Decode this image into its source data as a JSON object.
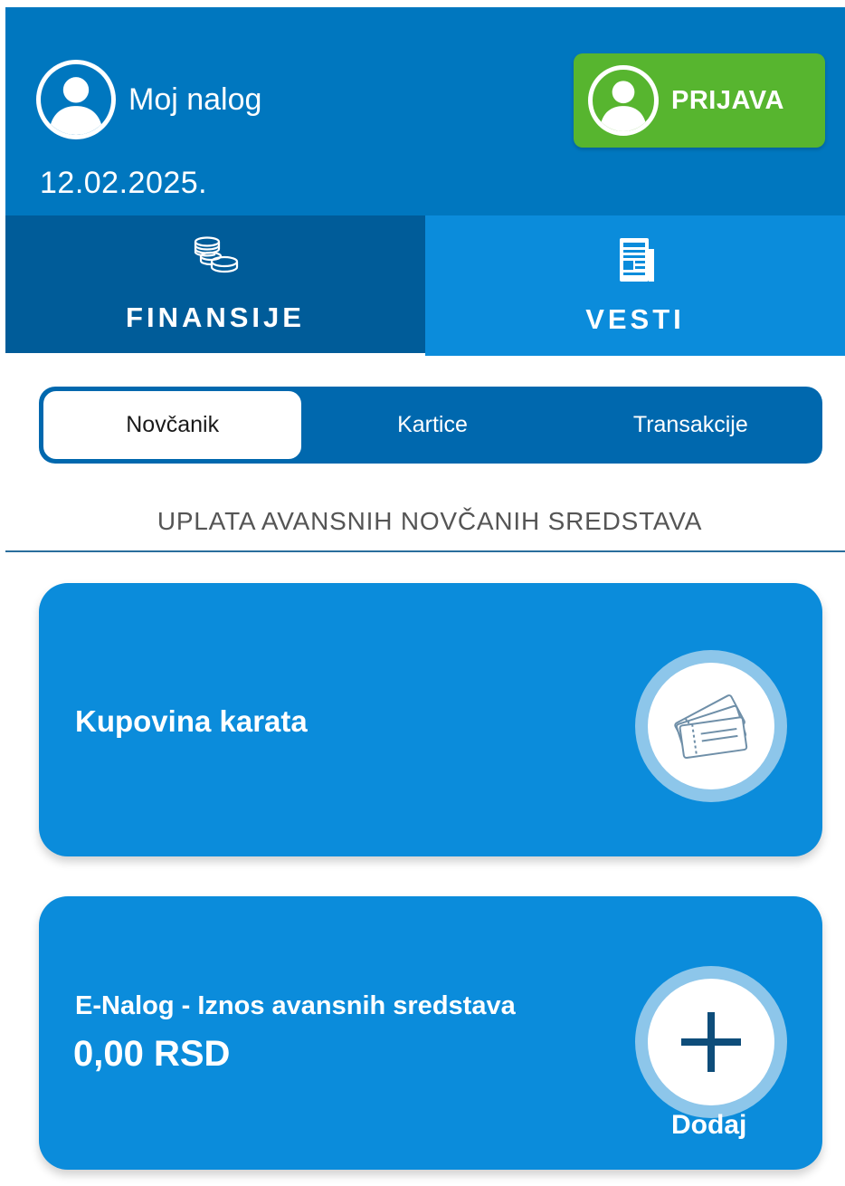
{
  "header": {
    "account_label": "Moj nalog",
    "date": "12.02.2025.",
    "login_label": "PRIJAVA"
  },
  "main_tabs": [
    {
      "label": "FINANSIJE",
      "icon": "coins-icon",
      "active": true
    },
    {
      "label": "VESTI",
      "icon": "newspaper-icon",
      "active": false
    }
  ],
  "sub_tabs": [
    {
      "label": "Novčanik",
      "selected": true
    },
    {
      "label": "Kartice",
      "selected": false
    },
    {
      "label": "Transakcije",
      "selected": false
    }
  ],
  "section_title": "UPLATA AVANSNIH NOVČANIH SREDSTAVA",
  "cards": {
    "tickets": {
      "title": "Kupovina karata",
      "icon": "tickets-icon"
    },
    "enalog": {
      "title": "E-Nalog - Iznos avansnih sredstava",
      "amount": "0,00 RSD",
      "add_label": "Dodaj",
      "icon": "plus-icon"
    }
  },
  "colors": {
    "header_blue": "#0077bf",
    "active_tab": "#005c99",
    "inactive_tab": "#0b8cdb",
    "login_green": "#57b52f",
    "card_blue": "#0b8cdb"
  }
}
